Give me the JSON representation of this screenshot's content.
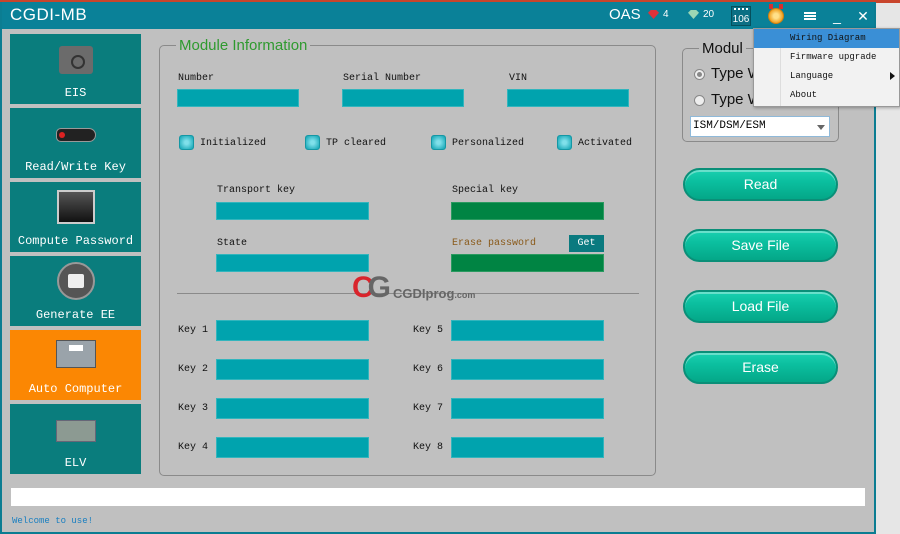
{
  "app": {
    "title": "CGDI-MB",
    "oas_label": "OAS",
    "red_gems": "4",
    "green_gems": "20",
    "calendar_count": "106",
    "colors": {
      "titlebar": "#0a8198",
      "sidebar": "#0a7d7d",
      "sidebar_active": "#fb8703",
      "field": "#00a3ae",
      "field_green": "#008443",
      "accent_button": "#0bbf9f"
    }
  },
  "window_controls": {
    "menu_icon": "hamburger-icon",
    "minimize": "_",
    "close": "✕"
  },
  "menu": {
    "items": [
      {
        "label": "Wiring Diagram",
        "highlighted": true
      },
      {
        "label": "Firmware upgrade"
      },
      {
        "label": "Language",
        "has_submenu": true
      },
      {
        "label": "About"
      }
    ]
  },
  "sidebar": {
    "items": [
      {
        "label": "EIS",
        "icon": "eis-icon"
      },
      {
        "label": "Read/Write Key",
        "icon": "car-key-icon"
      },
      {
        "label": "Compute Password",
        "icon": "password-chip-icon"
      },
      {
        "label": "Generate EE",
        "icon": "printer-icon"
      },
      {
        "label": "Auto Computer",
        "icon": "ecu-icon",
        "active": true
      },
      {
        "label": "ELV",
        "icon": "elv-board-icon"
      }
    ]
  },
  "module_info": {
    "title": "Module Information",
    "number_label": "Number",
    "number_value": "",
    "serial_label": "Serial Number",
    "serial_value": "",
    "vin_label": "VIN",
    "vin_value": "",
    "flags": [
      "Initialized",
      "TP cleared",
      "Personalized",
      "Activated"
    ],
    "transport_key_label": "Transport key",
    "transport_key_value": "",
    "special_key_label": "Special key",
    "special_key_value": "",
    "state_label": "State",
    "state_value": "",
    "erase_password_label": "Erase password",
    "erase_password_value": "",
    "get_label": "Get",
    "keys": [
      {
        "label": "Key 1",
        "value": ""
      },
      {
        "label": "Key 2",
        "value": ""
      },
      {
        "label": "Key 3",
        "value": ""
      },
      {
        "label": "Key 4",
        "value": ""
      },
      {
        "label": "Key 5",
        "value": ""
      },
      {
        "label": "Key 6",
        "value": ""
      },
      {
        "label": "Key 7",
        "value": ""
      },
      {
        "label": "Key 8",
        "value": ""
      }
    ]
  },
  "watermark": {
    "text": "CGDIprog",
    "suffix": ".com"
  },
  "module_select": {
    "title": "Modul",
    "radio_1": "Type W",
    "radio_2": "Type W",
    "selected_radio": 1,
    "dropdown_value": "ISM/DSM/ESM"
  },
  "actions": {
    "read": "Read",
    "save": "Save File",
    "load": "Load File",
    "erase": "Erase"
  },
  "status": {
    "progress": 0,
    "message": "Welcome to use!"
  }
}
